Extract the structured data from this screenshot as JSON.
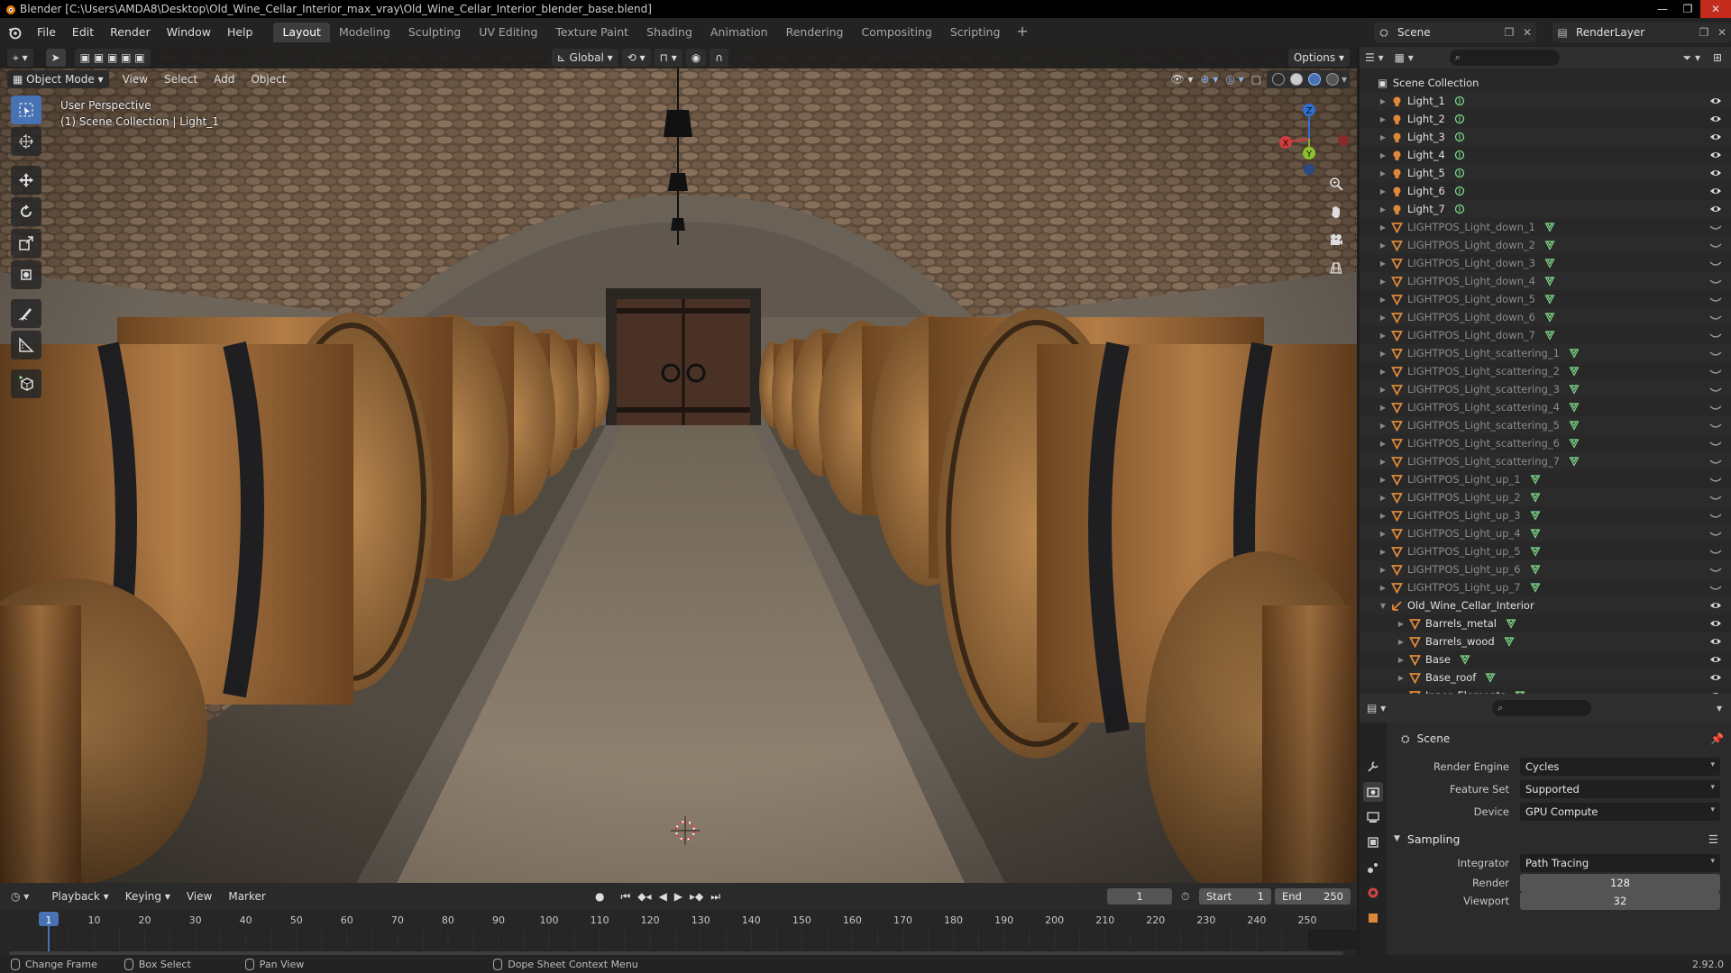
{
  "title_bar": {
    "text": "Blender [C:\\Users\\AMDA8\\Desktop\\Old_Wine_Cellar_Interior_max_vray\\Old_Wine_Cellar_Interior_blender_base.blend]"
  },
  "menus": [
    "File",
    "Edit",
    "Render",
    "Window",
    "Help"
  ],
  "workspaces": [
    {
      "label": "Layout",
      "active": true
    },
    {
      "label": "Modeling"
    },
    {
      "label": "Sculpting"
    },
    {
      "label": "UV Editing"
    },
    {
      "label": "Texture Paint"
    },
    {
      "label": "Shading"
    },
    {
      "label": "Animation"
    },
    {
      "label": "Rendering"
    },
    {
      "label": "Compositing"
    },
    {
      "label": "Scripting"
    }
  ],
  "scene_selector": "Scene",
  "layer_selector": "RenderLayer",
  "viewport": {
    "transform_orientation": "Global",
    "options_label": "Options",
    "mode": "Object Mode",
    "menu": [
      "View",
      "Select",
      "Add",
      "Object"
    ],
    "info_line1": "User Perspective",
    "info_line2": "(1) Scene Collection | Light_1",
    "gizmo": {
      "x": "X",
      "y": "Y",
      "z": "Z"
    }
  },
  "outliner": {
    "root": "Scene Collection",
    "items": [
      {
        "label": "Light_1",
        "type": "light",
        "visible": true
      },
      {
        "label": "Light_2",
        "type": "light",
        "visible": true
      },
      {
        "label": "Light_3",
        "type": "light",
        "visible": true
      },
      {
        "label": "Light_4",
        "type": "light",
        "visible": true
      },
      {
        "label": "Light_5",
        "type": "light",
        "visible": true
      },
      {
        "label": "Light_6",
        "type": "light",
        "visible": true
      },
      {
        "label": "Light_7",
        "type": "light",
        "visible": true
      },
      {
        "label": "LIGHTPOS_Light_down_1",
        "type": "mesh",
        "visible": false
      },
      {
        "label": "LIGHTPOS_Light_down_2",
        "type": "mesh",
        "visible": false
      },
      {
        "label": "LIGHTPOS_Light_down_3",
        "type": "mesh",
        "visible": false
      },
      {
        "label": "LIGHTPOS_Light_down_4",
        "type": "mesh",
        "visible": false
      },
      {
        "label": "LIGHTPOS_Light_down_5",
        "type": "mesh",
        "visible": false
      },
      {
        "label": "LIGHTPOS_Light_down_6",
        "type": "mesh",
        "visible": false
      },
      {
        "label": "LIGHTPOS_Light_down_7",
        "type": "mesh",
        "visible": false
      },
      {
        "label": "LIGHTPOS_Light_scattering_1",
        "type": "mesh",
        "visible": false
      },
      {
        "label": "LIGHTPOS_Light_scattering_2",
        "type": "mesh",
        "visible": false
      },
      {
        "label": "LIGHTPOS_Light_scattering_3",
        "type": "mesh",
        "visible": false
      },
      {
        "label": "LIGHTPOS_Light_scattering_4",
        "type": "mesh",
        "visible": false
      },
      {
        "label": "LIGHTPOS_Light_scattering_5",
        "type": "mesh",
        "visible": false
      },
      {
        "label": "LIGHTPOS_Light_scattering_6",
        "type": "mesh",
        "visible": false
      },
      {
        "label": "LIGHTPOS_Light_scattering_7",
        "type": "mesh",
        "visible": false
      },
      {
        "label": "LIGHTPOS_Light_up_1",
        "type": "mesh",
        "visible": false
      },
      {
        "label": "LIGHTPOS_Light_up_2",
        "type": "mesh",
        "visible": false
      },
      {
        "label": "LIGHTPOS_Light_up_3",
        "type": "mesh",
        "visible": false
      },
      {
        "label": "LIGHTPOS_Light_up_4",
        "type": "mesh",
        "visible": false
      },
      {
        "label": "LIGHTPOS_Light_up_5",
        "type": "mesh",
        "visible": false
      },
      {
        "label": "LIGHTPOS_Light_up_6",
        "type": "mesh",
        "visible": false
      },
      {
        "label": "LIGHTPOS_Light_up_7",
        "type": "mesh",
        "visible": false
      },
      {
        "label": "Old_Wine_Cellar_Interior",
        "type": "empty",
        "visible": true,
        "expanded": true
      },
      {
        "label": "Barrels_metal",
        "type": "mesh",
        "visible": true,
        "child": true
      },
      {
        "label": "Barrels_wood",
        "type": "mesh",
        "visible": true,
        "child": true
      },
      {
        "label": "Base",
        "type": "mesh",
        "visible": true,
        "child": true
      },
      {
        "label": "Base_roof",
        "type": "mesh",
        "visible": true,
        "child": true
      },
      {
        "label": "Inner_Elements",
        "type": "mesh",
        "visible": true,
        "child": true
      }
    ]
  },
  "properties": {
    "breadcrumb": "Scene",
    "render_engine_label": "Render Engine",
    "render_engine": "Cycles",
    "feature_set_label": "Feature Set",
    "feature_set": "Supported",
    "device_label": "Device",
    "device": "GPU Compute",
    "sampling_label": "Sampling",
    "integrator_label": "Integrator",
    "integrator": "Path Tracing",
    "render_label": "Render",
    "render_samples": "128",
    "viewport_label": "Viewport",
    "viewport_samples": "32"
  },
  "timeline": {
    "menu": [
      "Playback",
      "Keying",
      "View",
      "Marker"
    ],
    "current_frame": "1",
    "start_label": "Start",
    "start": "1",
    "end_label": "End",
    "end": "250",
    "ticks": [
      "1",
      "10",
      "20",
      "30",
      "40",
      "50",
      "60",
      "70",
      "80",
      "90",
      "100",
      "110",
      "120",
      "130",
      "140",
      "150",
      "160",
      "170",
      "180",
      "190",
      "200",
      "210",
      "220",
      "230",
      "240",
      "250"
    ]
  },
  "statusbar": {
    "items": [
      "Change Frame",
      "Box Select",
      "Pan View",
      "Dope Sheet Context Menu"
    ],
    "version": "2.92.0"
  },
  "colors": {
    "accent": "#4772b3",
    "light_icon": "#e0883a",
    "mesh_icon": "#7fd98a"
  }
}
